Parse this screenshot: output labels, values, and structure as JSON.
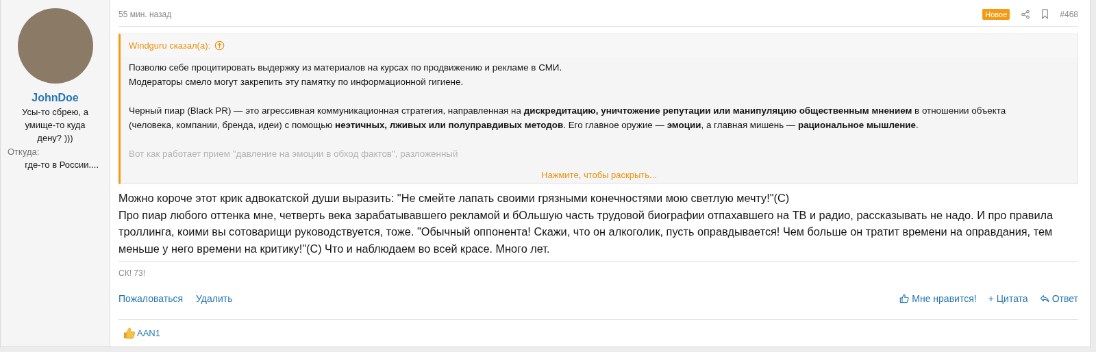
{
  "author": {
    "name": "JohnDoe",
    "title": "Усы-то сбрею, а умище-то куда дену? )))",
    "location_label": "Откуда:",
    "location": "где-то в России...."
  },
  "header": {
    "time": "55 мин. назад",
    "badge": "Новое",
    "number": "#468"
  },
  "quote": {
    "attribution": "Windguru сказал(а):",
    "paragraphs": [
      "Позволю себе процитировать выдержку из материалов на курсах по продвижению и рекламе в СМИ.\nМодераторы смело могут закрепить эту памятку по информационной гигиене.",
      "Черный пиар (Black PR) — это агрессивная коммуникационная стратегия, направленная на **дискредитацию, уничтожение репутации или манипуляцию общественным мнением** в отношении объекта (человека, компании, бренда, идеи) с помощью **неэтичных, лживых или полуправдивых методов**. Его главное оружие — **эмоции**, а главная мишень — **рациональное мышление**."
    ],
    "faded_line": "Вот как работает прием \"давление на эмоции в обход фактов\", разложенный",
    "expand": "Нажмите, чтобы раскрыть..."
  },
  "body": "Можно короче этот крик адвокатской души выразить: \"Не смейте лапать своими грязными конечностями мою светлую мечту!\"(С)\nПро пиар любого оттенка мне, четверть века зарабатывавшего рекламой и бОльшую часть трудовой биографии отпахавшего на ТВ и радио, рассказывать не надо. И про правила троллинга, коими вы сотоварищи руководствуется, тоже. \"Обычный оппонента! Скажи, что он алкоголик, пусть оправдывается! Чем больше он тратит времени на оправдания, тем меньше у него времени на критику!\"(С) Что и наблюдаем во всей красе. Много лет.",
  "signature": "СК! 73!",
  "actions_left": [
    {
      "label": "Пожаловаться"
    },
    {
      "label": "Удалить"
    }
  ],
  "actions_right": [
    {
      "kind": "like",
      "label": "Мне нравится!"
    },
    {
      "kind": "quote",
      "label": "+ Цитата"
    },
    {
      "kind": "reply",
      "label": "Ответ"
    }
  ],
  "reactions": [
    {
      "user": "AAN1"
    }
  ]
}
